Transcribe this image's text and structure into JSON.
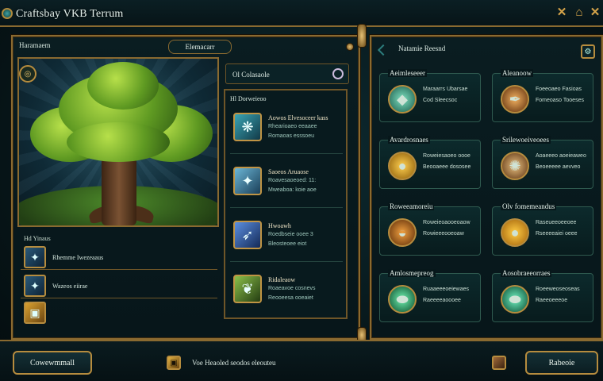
{
  "window": {
    "title": "Craftsbay VKB Terrum"
  },
  "controls": {
    "a": "✕",
    "b": "⌂",
    "c": "✕"
  },
  "left_panel": {
    "header": "Haramaem",
    "tab_label": "Elemacarr",
    "section_label": "Hd Yinaus",
    "rows": [
      {
        "label": "Rhemme Iwezeaaus",
        "icon": "crystal-icon"
      },
      {
        "label": "Wazeos eiirae",
        "icon": "crystal-icon"
      },
      {
        "label": "",
        "icon": "gold-frame-icon"
      }
    ]
  },
  "center": {
    "search_label": "Ol Colasaole",
    "list_header": "Hl Dorweieoo",
    "items": [
      {
        "title": "Aowos Elvesoceer kass",
        "line1": "Rhearioaeo eeaaee",
        "line2": "Romaoas esssoeu",
        "icon": "feather-icon"
      },
      {
        "title": "Saoeos Aruaose",
        "line1": "Roavesaoeoed: 11:",
        "line2": "Mweaboa: koie aoe",
        "icon": "crystal-icon"
      },
      {
        "title": "Hwoawh",
        "line1": "Roedbseie ooee 3",
        "line2": "Bleosteoee eiot",
        "icon": "wing-icon"
      },
      {
        "title": "Ridaleaow",
        "line1": "Roaeavoe cosnevs",
        "line2": "Reooeesa ooeaiet",
        "icon": "leaf-icon"
      }
    ]
  },
  "right_panel": {
    "header": "Natamie Reesnd",
    "cards": [
      {
        "title": "Aeimleseeer",
        "line1": "Maraarrs Ubarsae",
        "line2": "Cod  Sleecsoc",
        "icon": "gem-icon",
        "color": "#3fb49a"
      },
      {
        "title": "Aleanoow",
        "line1": "Foeeoaeo Fasioas",
        "line2": "Fomeoaso Tooeses",
        "icon": "quill-icon",
        "color": "#c9803a"
      },
      {
        "title": "Avardrosnaes",
        "line1": "Roweiesaoeo oooe",
        "line2": "Beooaeee dososee",
        "icon": "coin-icon",
        "color": "#d39a22"
      },
      {
        "title": "Srilewoeiveoees",
        "line1": "Aoaeeeo aoeieaweo",
        "line2": "Beoeeeee aevveo",
        "icon": "root-icon",
        "color": "#b87a3c"
      },
      {
        "title": "Roweeamoreiu",
        "line1": "Roweieoaooeoaow",
        "line2": "Rowieeeooeoaw",
        "icon": "bowl-icon",
        "color": "#b86a22"
      },
      {
        "title": "Olv fomemeandus",
        "line1": "Raseueeoeeoee",
        "line2": "Rseeeeaiei oeee",
        "icon": "gold-coin-icon",
        "color": "#e09a20"
      },
      {
        "title": "Amlosmepreog",
        "line1": "Ruaaeeeoeiewaes",
        "line2": "Raeeeeaoooee",
        "icon": "emerald-icon",
        "color": "#2fae7a"
      },
      {
        "title": "Aosobraeeorraes",
        "line1": "Roeeweoseoseas",
        "line2": "Raeeoeeeoe",
        "icon": "emerald-icon",
        "color": "#2fa882"
      }
    ]
  },
  "bottom": {
    "left_button": "Cowewmmall",
    "status": "Voe  Heaoled  seodos  eleouteu",
    "right_button": "Rabeoie"
  }
}
